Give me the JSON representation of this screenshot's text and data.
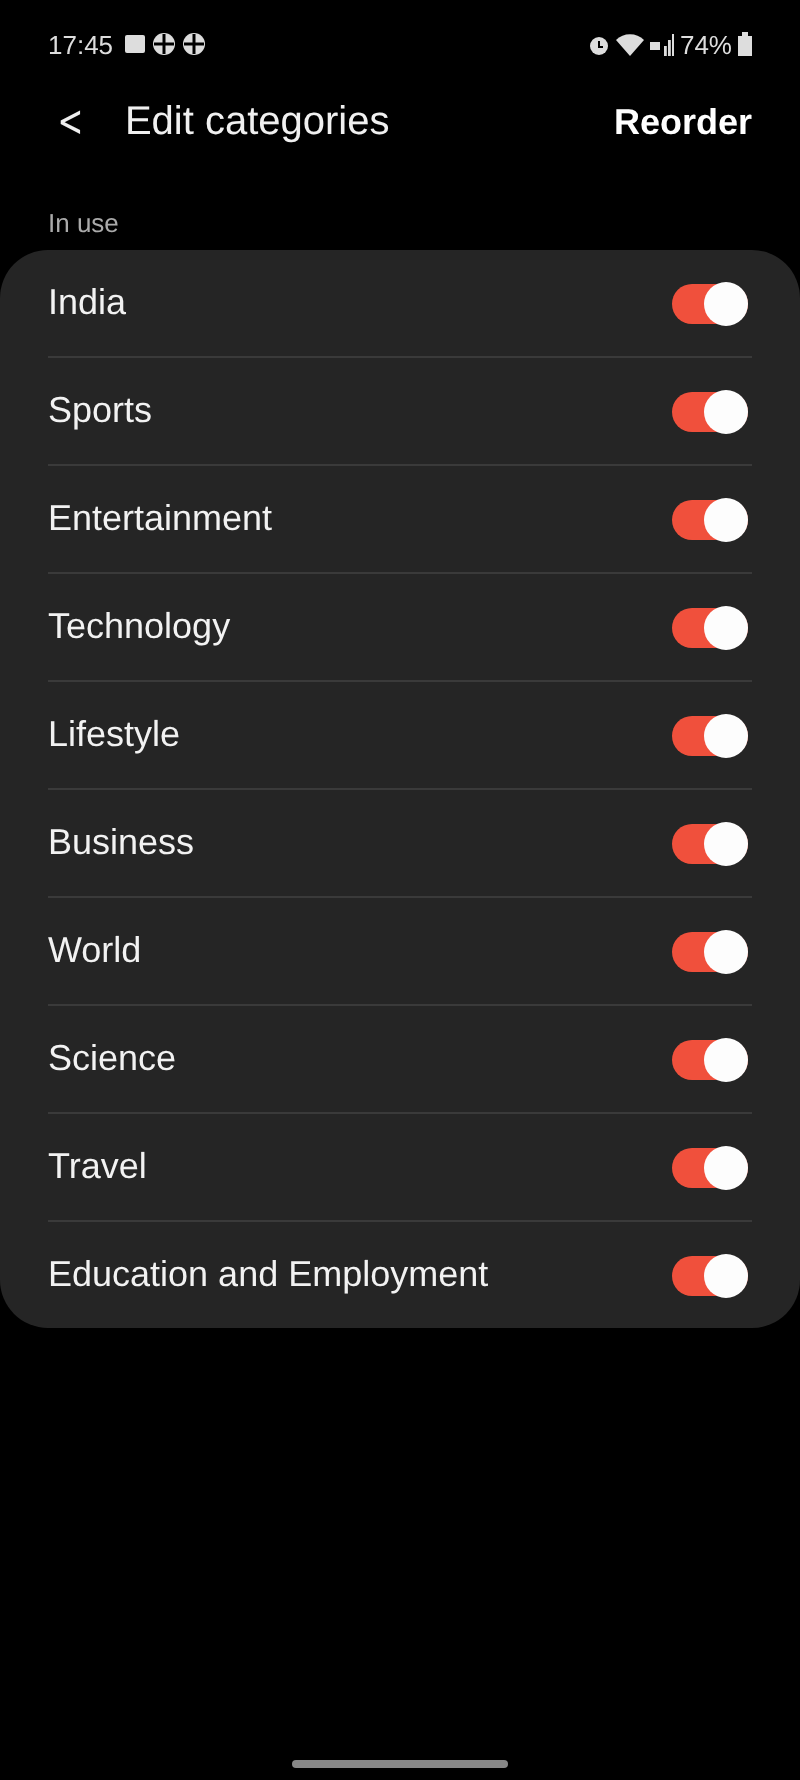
{
  "status_bar": {
    "time": "17:45",
    "battery": "74%"
  },
  "header": {
    "back": "<",
    "title": "Edit categories",
    "action": "Reorder"
  },
  "section": {
    "label": "In use"
  },
  "categories": [
    {
      "name": "India",
      "on": true
    },
    {
      "name": "Sports",
      "on": true
    },
    {
      "name": "Entertainment",
      "on": true
    },
    {
      "name": "Technology",
      "on": true
    },
    {
      "name": "Lifestyle",
      "on": true
    },
    {
      "name": "Business",
      "on": true
    },
    {
      "name": "World",
      "on": true
    },
    {
      "name": "Science",
      "on": true
    },
    {
      "name": "Travel",
      "on": true
    },
    {
      "name": "Education and Employment",
      "on": true
    }
  ]
}
